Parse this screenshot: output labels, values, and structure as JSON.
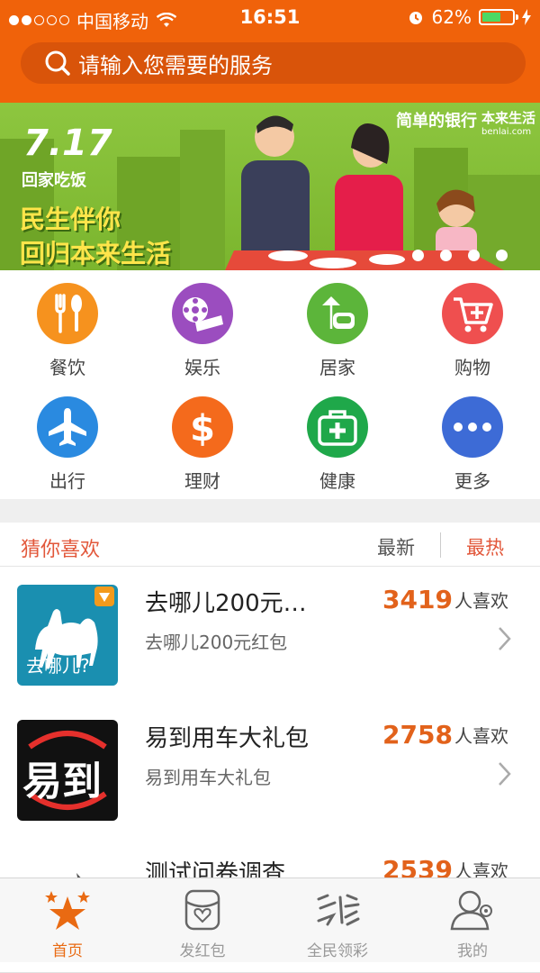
{
  "status_bar": {
    "carrier": "中国移动",
    "time": "16:51",
    "battery": "62%",
    "battery_level": 0.62
  },
  "search": {
    "placeholder": "请输入您需要的服务"
  },
  "banner": {
    "event": "7.17",
    "sub": "回家吃饭",
    "slogan_line1": "民生伴你",
    "slogan_line2": "回归本来生活",
    "brand_bank": "简单的银行",
    "brand_shop": "本来生活",
    "brand_shop_url": "benlai.com",
    "page_count": 4
  },
  "categories": [
    {
      "label": "餐饮",
      "icon": "fork-spoon-icon",
      "color": "#f6921e"
    },
    {
      "label": "娱乐",
      "icon": "film-reel-icon",
      "color": "#9b4dbf"
    },
    {
      "label": "居家",
      "icon": "lamp-chair-icon",
      "color": "#5cb53a"
    },
    {
      "label": "购物",
      "icon": "shopping-cart-icon",
      "color": "#ef4f4f"
    },
    {
      "label": "出行",
      "icon": "airplane-icon",
      "color": "#2a8ae0"
    },
    {
      "label": "理财",
      "icon": "dollar-icon",
      "color": "#f46a1c"
    },
    {
      "label": "健康",
      "icon": "medical-kit-icon",
      "color": "#1fa84a"
    },
    {
      "label": "更多",
      "icon": "more-dots-icon",
      "color": "#3d6bd6"
    }
  ],
  "recommend": {
    "title": "猜你喜欢",
    "tab_latest": "最新",
    "tab_hot": "最热",
    "likes_suffix": "人喜欢",
    "items": [
      {
        "name": "去哪儿200元…",
        "desc": "去哪儿200元红包",
        "count": "3419",
        "logo_text": "去哪儿?"
      },
      {
        "name": "易到用车大礼包",
        "desc": "易到用车大礼包",
        "count": "2758",
        "logo_text": "易到"
      },
      {
        "name": "测试问卷调查",
        "desc": "",
        "count": "2539"
      }
    ]
  },
  "tabbar": [
    {
      "label": "首页",
      "icon": "star-cluster-icon",
      "active": true
    },
    {
      "label": "发红包",
      "icon": "red-packet-icon",
      "active": false
    },
    {
      "label": "全民领彩",
      "icon": "lottery-icon",
      "active": false
    },
    {
      "label": "我的",
      "icon": "profile-icon",
      "active": false
    }
  ],
  "colors": {
    "brand": "#f0620a",
    "accent": "#e2621b",
    "active_tab": "#e96a12"
  }
}
